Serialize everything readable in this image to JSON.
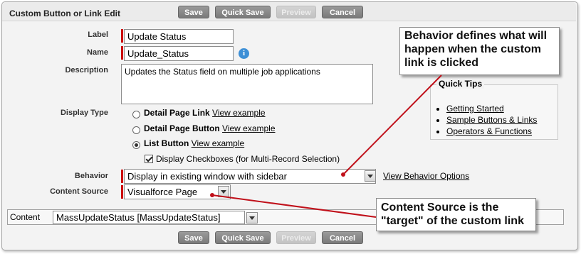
{
  "header": {
    "title": "Custom Button or Link Edit"
  },
  "buttons": {
    "save": "Save",
    "quick_save": "Quick Save",
    "preview": "Preview",
    "cancel": "Cancel"
  },
  "form": {
    "label_label": "Label",
    "label_value": "Update Status",
    "name_label": "Name",
    "name_value": "Update_Status",
    "description_label": "Description",
    "description_value": "Updates the Status field on multiple job applications",
    "display_type_label": "Display Type",
    "display_options": [
      {
        "label": "Detail Page Link",
        "link": "View example",
        "selected": false
      },
      {
        "label": "Detail Page Button",
        "link": "View example",
        "selected": false
      },
      {
        "label": "List Button",
        "link": "View example",
        "selected": true
      }
    ],
    "checkbox_label": "Display Checkboxes (for Multi-Record Selection)",
    "checkbox_checked": true,
    "behavior_label": "Behavior",
    "behavior_value": "Display in existing window with sidebar",
    "behavior_link": "View Behavior Options",
    "content_source_label": "Content Source",
    "content_source_value": "Visualforce Page",
    "content_label": "Content",
    "content_value": "MassUpdateStatus [MassUpdateStatus]"
  },
  "quick_tips": {
    "title": "Quick Tips",
    "links": [
      "Getting Started",
      "Sample Buttons & Links",
      "Operators & Functions"
    ]
  },
  "callouts": {
    "behavior": "Behavior defines what will happen when the custom link is clicked",
    "content_source": "Content Source is the \"target\" of the custom link"
  },
  "colors": {
    "required": "#cc0000",
    "arrow": "#c0101a"
  }
}
